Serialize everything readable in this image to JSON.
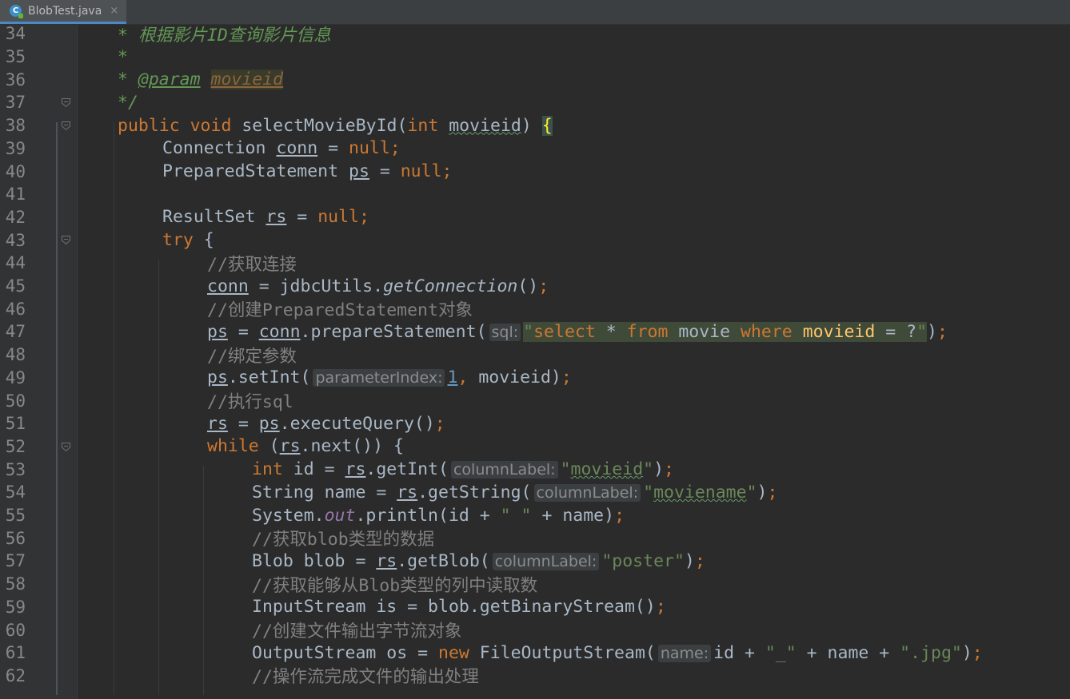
{
  "tab": {
    "filename": "BlobTest.java",
    "icon": "java-class-icon",
    "close": "×"
  },
  "lines": [
    {
      "n": "34",
      "indent": 0,
      "tokens": [
        [
          "doc",
          "* 根据影片ID查询影片信息"
        ]
      ]
    },
    {
      "n": "35",
      "indent": 0,
      "tokens": [
        [
          "doc",
          "*"
        ]
      ]
    },
    {
      "n": "36",
      "indent": 0,
      "tokens": [
        [
          "doc",
          "* "
        ],
        [
          "doctag",
          "@param"
        ],
        [
          "doc",
          " "
        ],
        [
          "docparam",
          "movieid"
        ]
      ]
    },
    {
      "n": "37",
      "indent": 0,
      "tokens": [
        [
          "doc",
          "*/"
        ]
      ]
    },
    {
      "n": "38",
      "indent": 0,
      "tokens": [
        [
          "kw",
          "public "
        ],
        [
          "kw",
          "void "
        ],
        [
          "fn",
          "selectMovieById("
        ],
        [
          "kw",
          "int "
        ],
        [
          "typo",
          "movieid"
        ],
        [
          "nm",
          ") "
        ],
        [
          "brace-match",
          "{"
        ]
      ]
    },
    {
      "n": "39",
      "indent": 1,
      "tokens": [
        [
          "nm",
          "Connection "
        ],
        [
          "under",
          "conn"
        ],
        [
          "nm",
          " = "
        ],
        [
          "kw",
          "null"
        ],
        [
          "kw",
          ";"
        ]
      ]
    },
    {
      "n": "40",
      "indent": 1,
      "tokens": [
        [
          "nm",
          "PreparedStatement "
        ],
        [
          "under",
          "ps"
        ],
        [
          "nm",
          " = "
        ],
        [
          "kw",
          "null"
        ],
        [
          "kw",
          ";"
        ]
      ]
    },
    {
      "n": "41",
      "indent": 1,
      "tokens": []
    },
    {
      "n": "42",
      "indent": 1,
      "tokens": [
        [
          "nm",
          "ResultSet "
        ],
        [
          "under",
          "rs"
        ],
        [
          "nm",
          " = "
        ],
        [
          "kw",
          "null"
        ],
        [
          "kw",
          ";"
        ]
      ]
    },
    {
      "n": "43",
      "indent": 1,
      "tokens": [
        [
          "kw",
          "try "
        ],
        [
          "nm",
          "{"
        ]
      ]
    },
    {
      "n": "44",
      "indent": 2,
      "tokens": [
        [
          "cm",
          "//获取连接"
        ]
      ]
    },
    {
      "n": "45",
      "indent": 2,
      "tokens": [
        [
          "under",
          "conn"
        ],
        [
          "nm",
          " = jdbcUtils."
        ],
        [
          "static",
          "getConnection"
        ],
        [
          "nm",
          "()"
        ],
        [
          "kw",
          ";"
        ]
      ]
    },
    {
      "n": "46",
      "indent": 2,
      "tokens": [
        [
          "cm",
          "//创建PreparedStatement对象"
        ]
      ]
    },
    {
      "n": "47",
      "indent": 2,
      "tokens": [
        [
          "under",
          "ps"
        ],
        [
          "nm",
          " = "
        ],
        [
          "under",
          "conn"
        ],
        [
          "nm",
          ".prepareStatement("
        ],
        [
          "hint",
          "sql:"
        ],
        [
          "str",
          "\""
        ],
        [
          "sqlkw",
          "select"
        ],
        [
          "sqltxt",
          " * "
        ],
        [
          "sqlkw",
          "from"
        ],
        [
          "sqltxt",
          " movie "
        ],
        [
          "sqlkw",
          "where"
        ],
        [
          "sqltxt",
          " "
        ],
        [
          "sqlcol",
          "movieid"
        ],
        [
          "sqltxt",
          " = ?"
        ],
        [
          "str",
          "\""
        ],
        [
          "nm",
          ")"
        ],
        [
          "kw",
          ";"
        ]
      ]
    },
    {
      "n": "48",
      "indent": 2,
      "tokens": [
        [
          "cm",
          "//绑定参数"
        ]
      ]
    },
    {
      "n": "49",
      "indent": 2,
      "tokens": [
        [
          "under",
          "ps"
        ],
        [
          "nm",
          ".setInt("
        ],
        [
          "hint",
          "parameterIndex:"
        ],
        [
          "num-u",
          "1"
        ],
        [
          "kw",
          ", "
        ],
        [
          "nm",
          "movieid)"
        ],
        [
          "kw",
          ";"
        ]
      ]
    },
    {
      "n": "50",
      "indent": 2,
      "tokens": [
        [
          "cm",
          "//执行sql"
        ]
      ]
    },
    {
      "n": "51",
      "indent": 2,
      "tokens": [
        [
          "under",
          "rs"
        ],
        [
          "nm",
          " = "
        ],
        [
          "under",
          "ps"
        ],
        [
          "nm",
          ".executeQuery()"
        ],
        [
          "kw",
          ";"
        ]
      ]
    },
    {
      "n": "52",
      "indent": 2,
      "tokens": [
        [
          "kw",
          "while "
        ],
        [
          "nm",
          "("
        ],
        [
          "under",
          "rs"
        ],
        [
          "nm",
          ".next()) {"
        ]
      ]
    },
    {
      "n": "53",
      "indent": 3,
      "tokens": [
        [
          "kw",
          "int "
        ],
        [
          "nm",
          "id = "
        ],
        [
          "under",
          "rs"
        ],
        [
          "nm",
          ".getInt("
        ],
        [
          "hint",
          "columnLabel:"
        ],
        [
          "str",
          "\""
        ],
        [
          "str-typo",
          "movieid"
        ],
        [
          "str",
          "\""
        ],
        [
          "nm",
          ")"
        ],
        [
          "kw",
          ";"
        ]
      ]
    },
    {
      "n": "54",
      "indent": 3,
      "tokens": [
        [
          "nm",
          "String name = "
        ],
        [
          "under",
          "rs"
        ],
        [
          "nm",
          ".getString("
        ],
        [
          "hint",
          "columnLabel:"
        ],
        [
          "str",
          "\""
        ],
        [
          "str-typo",
          "moviename"
        ],
        [
          "str",
          "\""
        ],
        [
          "nm",
          ")"
        ],
        [
          "kw",
          ";"
        ]
      ]
    },
    {
      "n": "55",
      "indent": 3,
      "tokens": [
        [
          "nm",
          "System."
        ],
        [
          "field",
          "out"
        ],
        [
          "nm",
          ".println(id + "
        ],
        [
          "str",
          "\" \""
        ],
        [
          "nm",
          " + name)"
        ],
        [
          "kw",
          ";"
        ]
      ]
    },
    {
      "n": "56",
      "indent": 3,
      "tokens": [
        [
          "cm",
          "//获取blob类型的数据"
        ]
      ]
    },
    {
      "n": "57",
      "indent": 3,
      "tokens": [
        [
          "nm",
          "Blob blob = "
        ],
        [
          "under",
          "rs"
        ],
        [
          "nm",
          ".getBlob("
        ],
        [
          "hint",
          "columnLabel:"
        ],
        [
          "str",
          "\"poster\""
        ],
        [
          "nm",
          ")"
        ],
        [
          "kw",
          ";"
        ]
      ]
    },
    {
      "n": "58",
      "indent": 3,
      "tokens": [
        [
          "cm",
          "//获取能够从Blob类型的列中读取数"
        ]
      ]
    },
    {
      "n": "59",
      "indent": 3,
      "tokens": [
        [
          "nm",
          "InputStream is = blob.getBinaryStream()"
        ],
        [
          "kw",
          ";"
        ]
      ]
    },
    {
      "n": "60",
      "indent": 3,
      "tokens": [
        [
          "cm",
          "//创建文件输出字节流对象"
        ]
      ]
    },
    {
      "n": "61",
      "indent": 3,
      "tokens": [
        [
          "nm",
          "OutputStream os = "
        ],
        [
          "kw",
          "new "
        ],
        [
          "nm",
          "FileOutputStream("
        ],
        [
          "hint",
          "name:"
        ],
        [
          "nm",
          "id + "
        ],
        [
          "str",
          "\"_\""
        ],
        [
          "nm",
          " + name + "
        ],
        [
          "str",
          "\".jpg\""
        ],
        [
          "nm",
          ")"
        ],
        [
          "kw",
          ";"
        ]
      ]
    },
    {
      "n": "62",
      "indent": 3,
      "tokens": [
        [
          "cm",
          "//操作流完成文件的输出处理"
        ]
      ]
    }
  ]
}
